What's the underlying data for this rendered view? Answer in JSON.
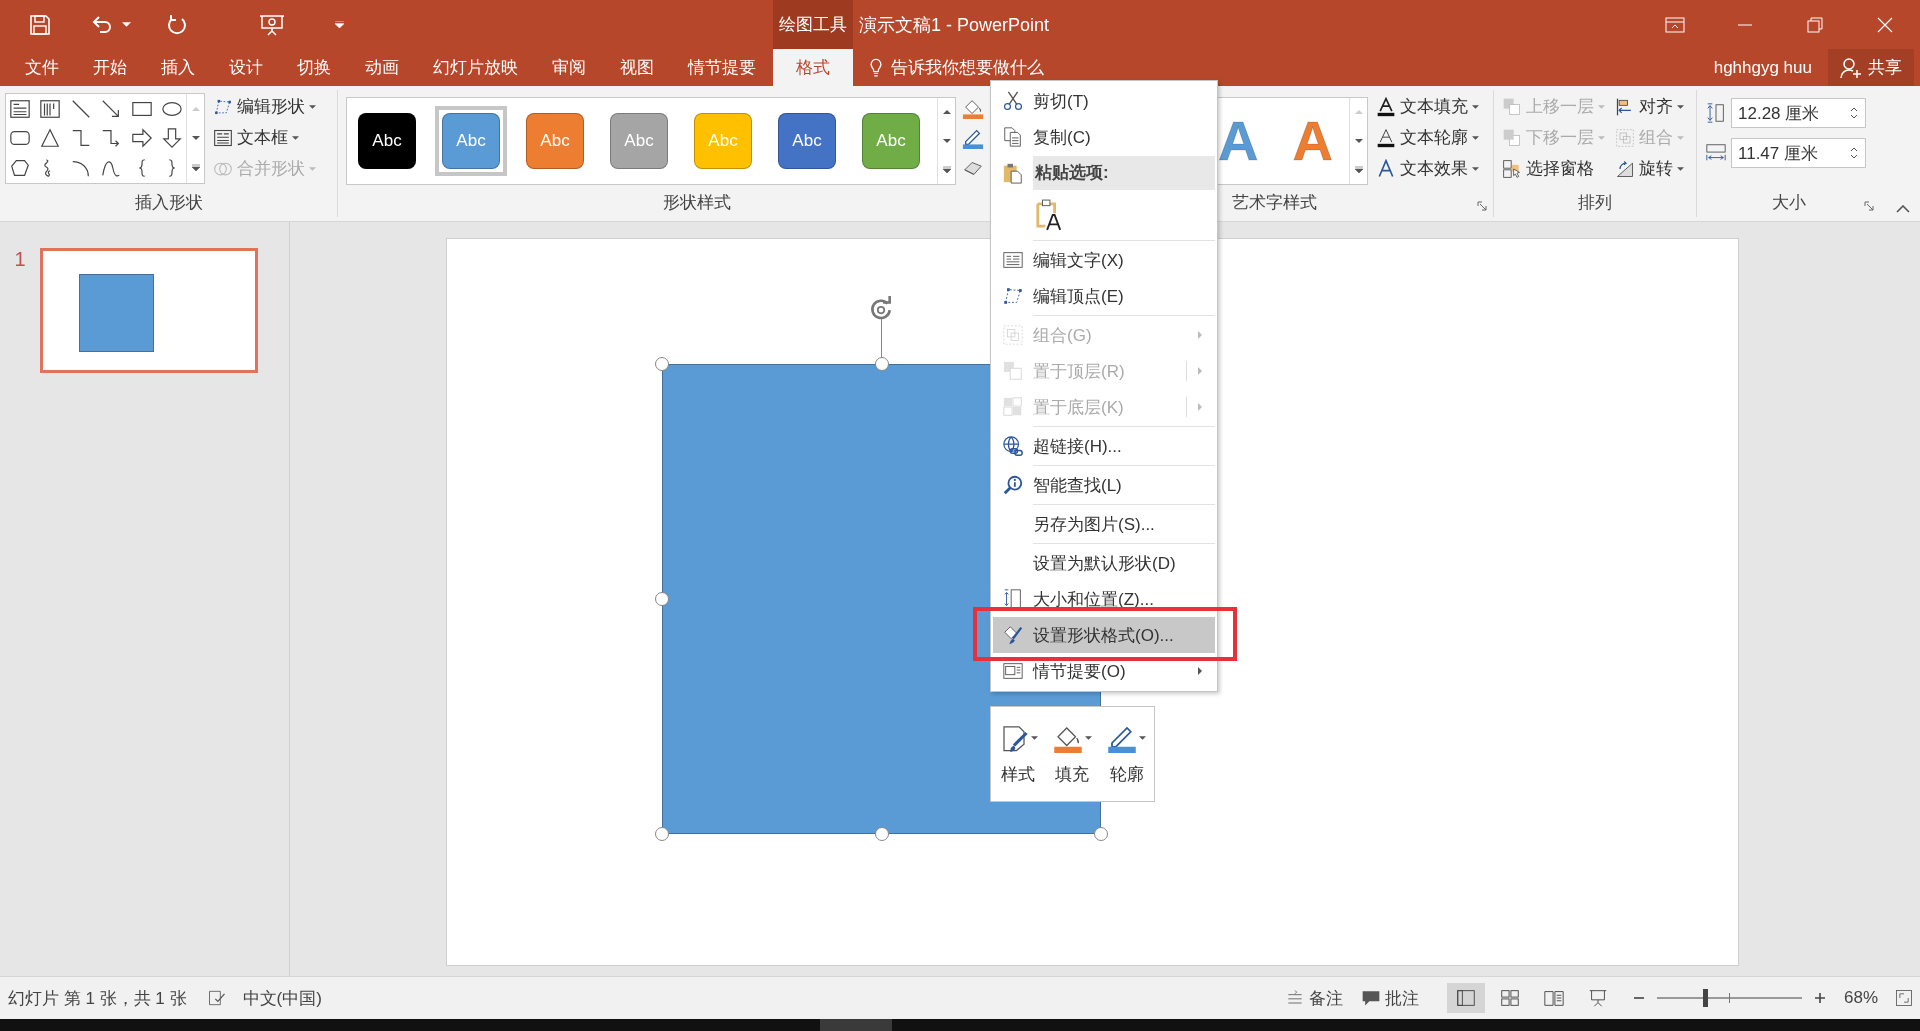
{
  "title_bar": {
    "context_label": "绘图工具",
    "title": "演示文稿1 - PowerPoint"
  },
  "tabs": [
    {
      "label": "文件",
      "selected": false
    },
    {
      "label": "开始",
      "selected": false
    },
    {
      "label": "插入",
      "selected": false
    },
    {
      "label": "设计",
      "selected": false
    },
    {
      "label": "切换",
      "selected": false
    },
    {
      "label": "动画",
      "selected": false
    },
    {
      "label": "幻灯片放映",
      "selected": false
    },
    {
      "label": "审阅",
      "selected": false
    },
    {
      "label": "视图",
      "selected": false
    },
    {
      "label": "情节提要",
      "selected": false
    },
    {
      "label": "格式",
      "selected": true
    }
  ],
  "tell_me": {
    "placeholder": "告诉我你想要做什么"
  },
  "account": {
    "user": "hghhgyg huu",
    "share": "共享"
  },
  "ribbon": {
    "insert_shapes": {
      "label": "插入形状",
      "commands": [
        {
          "label": "编辑形状",
          "disabled": false
        },
        {
          "label": "文本框",
          "disabled": false
        },
        {
          "label": "合并形状",
          "disabled": true
        }
      ]
    },
    "shape_styles": {
      "label": "形状样式",
      "styles": [
        {
          "label": "Abc",
          "color": "#000000",
          "selected": false
        },
        {
          "label": "Abc",
          "color": "#5b9bd5",
          "selected": true
        },
        {
          "label": "Abc",
          "color": "#ed7d31",
          "selected": false
        },
        {
          "label": "Abc",
          "color": "#a5a5a5",
          "selected": false
        },
        {
          "label": "Abc",
          "color": "#ffc000",
          "selected": false
        },
        {
          "label": "Abc",
          "color": "#4472c4",
          "selected": false
        },
        {
          "label": "Abc",
          "color": "#70ad47",
          "selected": false
        }
      ]
    },
    "wordart_styles": {
      "label": "艺术字样式",
      "previews": [
        {
          "label": "A",
          "color": "#5b9bd5"
        },
        {
          "label": "A",
          "color": "#ed7d31"
        }
      ],
      "commands": [
        {
          "label": "文本填充"
        },
        {
          "label": "文本轮廓"
        },
        {
          "label": "文本效果"
        }
      ]
    },
    "arrange": {
      "label": "排列",
      "commands": [
        {
          "label": "上移一层",
          "disabled": true
        },
        {
          "label": "下移一层",
          "disabled": true
        },
        {
          "label": "选择窗格",
          "disabled": false
        },
        {
          "label": "对齐",
          "disabled": false
        },
        {
          "label": "组合",
          "disabled": true
        },
        {
          "label": "旋转",
          "disabled": false
        }
      ]
    },
    "size": {
      "label": "大小",
      "height": "12.28 厘米",
      "width": "11.47 厘米"
    }
  },
  "slides": [
    {
      "number": "1",
      "selected": true
    }
  ],
  "context_menu": [
    {
      "kind": "item",
      "label": "剪切(T)",
      "disabled": false,
      "selected": false,
      "annotated": false
    },
    {
      "kind": "item",
      "label": "复制(C)",
      "disabled": false,
      "selected": false,
      "annotated": false
    },
    {
      "kind": "header",
      "label": "粘贴选项:"
    },
    {
      "kind": "paste_option"
    },
    {
      "kind": "separator"
    },
    {
      "kind": "item",
      "label": "编辑文字(X)",
      "disabled": false,
      "selected": false,
      "annotated": false
    },
    {
      "kind": "item",
      "label": "编辑顶点(E)",
      "disabled": false,
      "selected": false,
      "annotated": false
    },
    {
      "kind": "separator"
    },
    {
      "kind": "submenu",
      "label": "组合(G)",
      "disabled": true,
      "selected": false,
      "annotated": false
    },
    {
      "kind": "split_submenu",
      "label": "置于顶层(R)",
      "disabled": true,
      "selected": false,
      "annotated": false
    },
    {
      "kind": "split_submenu",
      "label": "置于底层(K)",
      "disabled": true,
      "selected": false,
      "annotated": false
    },
    {
      "kind": "separator"
    },
    {
      "kind": "item",
      "label": "超链接(H)...",
      "disabled": false,
      "selected": false,
      "annotated": false
    },
    {
      "kind": "separator"
    },
    {
      "kind": "item",
      "label": "智能查找(L)",
      "disabled": false,
      "selected": false,
      "annotated": false
    },
    {
      "kind": "separator"
    },
    {
      "kind": "item",
      "label": "另存为图片(S)...",
      "disabled": false,
      "selected": false,
      "annotated": false
    },
    {
      "kind": "separator"
    },
    {
      "kind": "item",
      "label": "设置为默认形状(D)",
      "disabled": false,
      "selected": false,
      "annotated": false
    },
    {
      "kind": "item",
      "label": "大小和位置(Z)...",
      "disabled": false,
      "selected": false,
      "annotated": false
    },
    {
      "kind": "item",
      "label": "设置形状格式(O)...",
      "disabled": false,
      "selected": true,
      "annotated": true
    },
    {
      "kind": "submenu",
      "label": "情节提要(O)",
      "disabled": false,
      "selected": false,
      "annotated": false
    }
  ],
  "mini_toolbar": [
    {
      "label": "样式"
    },
    {
      "label": "填充"
    },
    {
      "label": "轮廓"
    }
  ],
  "status_bar": {
    "slide_info": "幻灯片 第 1 张，共 1 张",
    "language": "中文(中国)",
    "notes": "备注",
    "comments": "批注",
    "views": [
      {
        "selected": true
      },
      {
        "selected": false
      },
      {
        "selected": false
      },
      {
        "selected": false
      }
    ],
    "zoom": {
      "level": 0.33,
      "reading": "68%"
    }
  }
}
